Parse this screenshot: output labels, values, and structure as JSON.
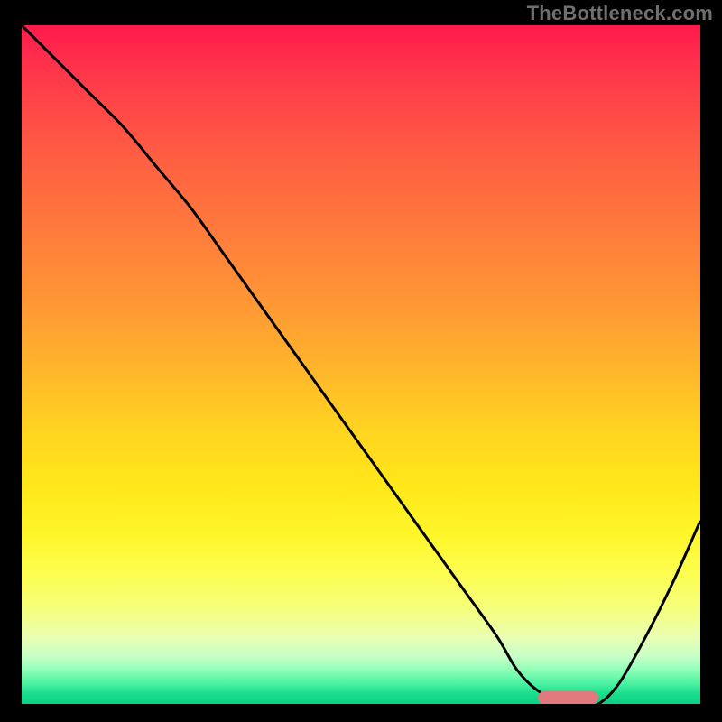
{
  "watermark": "TheBottleneck.com",
  "chart_data": {
    "type": "line",
    "title": "",
    "xlabel": "",
    "ylabel": "",
    "xlim": [
      0,
      100
    ],
    "ylim": [
      0,
      100
    ],
    "grid": false,
    "background_gradient": {
      "orientation": "vertical",
      "stops": [
        {
          "pos": 0.0,
          "color": "#ff1a4d"
        },
        {
          "pos": 0.5,
          "color": "#ffba2a"
        },
        {
          "pos": 0.8,
          "color": "#fcfe52"
        },
        {
          "pos": 0.95,
          "color": "#8effb7"
        },
        {
          "pos": 1.0,
          "color": "#0bd083"
        }
      ]
    },
    "series": [
      {
        "name": "bottleneck-curve",
        "color": "#000000",
        "x": [
          0,
          5,
          10,
          15,
          20,
          25,
          30,
          35,
          40,
          45,
          50,
          55,
          60,
          65,
          70,
          73,
          76,
          80,
          83,
          85,
          88,
          92,
          96,
          100
        ],
        "y": [
          100,
          95,
          90,
          85,
          79,
          73,
          66,
          59,
          52,
          45,
          38,
          31,
          24,
          17,
          10,
          5,
          2,
          0,
          0,
          0,
          3,
          10,
          18,
          27
        ]
      }
    ],
    "marker": {
      "name": "optimal-range",
      "x_start": 76,
      "x_end": 85,
      "color": "#e07a7f"
    }
  }
}
